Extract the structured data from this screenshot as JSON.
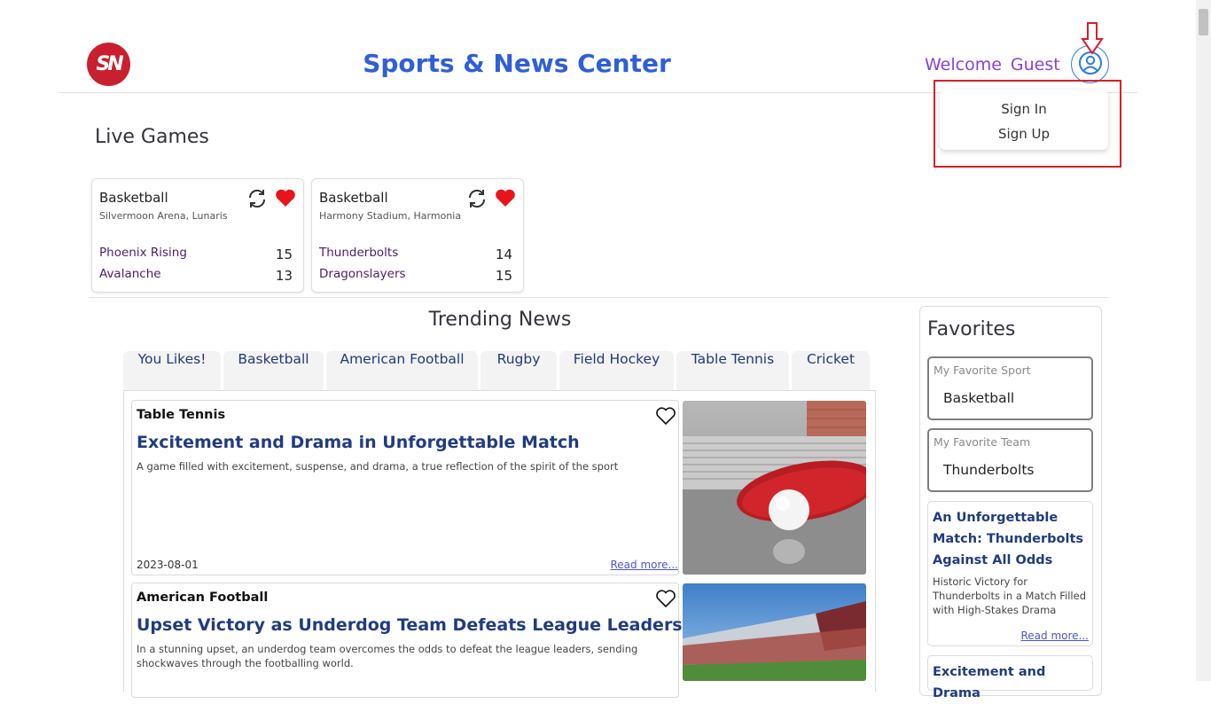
{
  "header": {
    "logo_text": "SN",
    "title": "Sports & News Center",
    "welcome": "Welcome",
    "user_name": "Guest"
  },
  "user_menu": {
    "items": [
      "Sign In",
      "Sign Up"
    ]
  },
  "live_games": {
    "heading": "Live Games",
    "games": [
      {
        "sport": "Basketball",
        "venue": "Silvermoon Arena, Lunaris",
        "teams": [
          {
            "name": "Phoenix Rising",
            "score": "15"
          },
          {
            "name": "Avalanche",
            "score": "13"
          }
        ]
      },
      {
        "sport": "Basketball",
        "venue": "Harmony Stadium, Harmonia",
        "teams": [
          {
            "name": "Thunderbolts",
            "score": "14"
          },
          {
            "name": "Dragonslayers",
            "score": "15"
          }
        ]
      }
    ]
  },
  "trending": {
    "heading": "Trending News",
    "tabs": [
      "You Likes!",
      "Basketball",
      "American Football",
      "Rugby",
      "Field Hockey",
      "Table Tennis",
      "Cricket"
    ],
    "articles": [
      {
        "category": "Table Tennis",
        "title": "Excitement and Drama in Unforgettable Match",
        "description": "A game filled with excitement, suspense, and drama, a true reflection of the spirit of the sport",
        "date": "2023-08-01",
        "read_more": "Read more..."
      },
      {
        "category": "American Football",
        "title": "Upset Victory as Underdog Team Defeats League Leaders",
        "description": "In a stunning upset, an underdog team overcomes the odds to defeat the league leaders, sending shockwaves through the footballing world."
      }
    ]
  },
  "favorites": {
    "heading": "Favorites",
    "sport_label": "My Favorite Sport",
    "sport_value": "Basketball",
    "team_label": "My Favorite Team",
    "team_value": "Thunderbolts",
    "news": [
      {
        "title": "An Unforgettable Match: Thunderbolts Against All Odds",
        "description": "Historic Victory for Thunderbolts in a Match Filled with High-Stakes Drama",
        "read_more": "Read more..."
      },
      {
        "title": "Excitement and Drama"
      }
    ]
  },
  "colors": {
    "brand_red": "#c8202f",
    "title_blue": "#2f5fd7",
    "welcome_purple": "#8a3fe0",
    "heart_red": "#e8141c",
    "highlight_red": "#d6202a"
  }
}
